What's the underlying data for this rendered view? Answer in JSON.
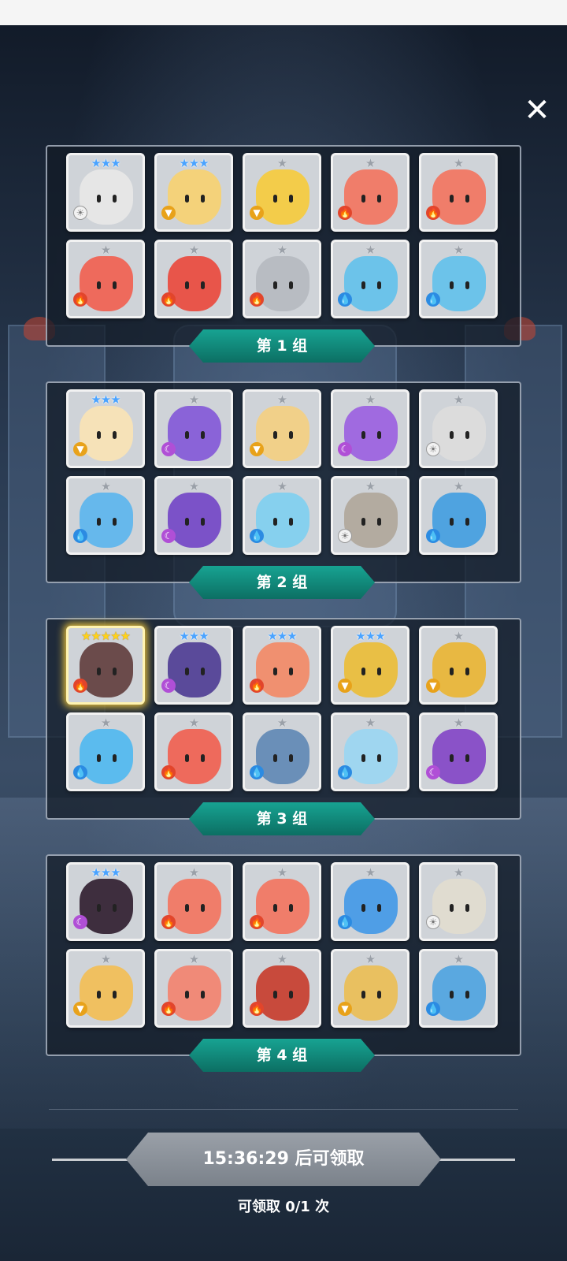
{
  "ui": {
    "close_symbol": "✕",
    "claim_button_label": "15:36:29 后可领取",
    "claim_count_text": "可领取 0/1 次"
  },
  "groups": [
    {
      "label": "第 1 组",
      "heroes": [
        {
          "stars": "★★★",
          "star_color": "blue",
          "element": "light",
          "color": "#e6e6e6"
        },
        {
          "stars": "★★★",
          "star_color": "blue",
          "element": "earth",
          "color": "#f4d27a"
        },
        {
          "stars": "★",
          "star_color": "grey",
          "element": "earth",
          "color": "#f3cc4a"
        },
        {
          "stars": "★",
          "star_color": "grey",
          "element": "fire",
          "color": "#f07d6a"
        },
        {
          "stars": "★",
          "star_color": "grey",
          "element": "fire",
          "color": "#f07d6a"
        },
        {
          "stars": "★",
          "star_color": "grey",
          "element": "fire",
          "color": "#ee6a5c"
        },
        {
          "stars": "★",
          "star_color": "grey",
          "element": "fire",
          "color": "#e8554a"
        },
        {
          "stars": "★",
          "star_color": "grey",
          "element": "fire",
          "color": "#b8bcc2"
        },
        {
          "stars": "★",
          "star_color": "grey",
          "element": "water",
          "color": "#6cc3ea"
        },
        {
          "stars": "★",
          "star_color": "grey",
          "element": "water",
          "color": "#6cc3ea"
        }
      ]
    },
    {
      "label": "第 2 组",
      "heroes": [
        {
          "stars": "★★★",
          "star_color": "blue",
          "element": "earth",
          "color": "#f6e2b8"
        },
        {
          "stars": "★",
          "star_color": "grey",
          "element": "dark",
          "color": "#8a63d8"
        },
        {
          "stars": "★",
          "star_color": "grey",
          "element": "earth",
          "color": "#f1d089"
        },
        {
          "stars": "★",
          "star_color": "grey",
          "element": "dark",
          "color": "#a06ae0"
        },
        {
          "stars": "★",
          "star_color": "grey",
          "element": "light",
          "color": "#dcdcdc"
        },
        {
          "stars": "★",
          "star_color": "grey",
          "element": "water",
          "color": "#66b8ec"
        },
        {
          "stars": "★",
          "star_color": "grey",
          "element": "dark",
          "color": "#7b52c8"
        },
        {
          "stars": "★",
          "star_color": "grey",
          "element": "water",
          "color": "#86d0ee"
        },
        {
          "stars": "★",
          "star_color": "grey",
          "element": "light",
          "color": "#b3aba0"
        },
        {
          "stars": "★",
          "star_color": "grey",
          "element": "water",
          "color": "#4fa3e0"
        }
      ]
    },
    {
      "label": "第 3 组",
      "heroes": [
        {
          "stars": "★★★★★",
          "star_color": "gold",
          "element": "fire",
          "color": "#6b4b4b",
          "highlight": true
        },
        {
          "stars": "★★★",
          "star_color": "blue",
          "element": "dark",
          "color": "#5a4a9a"
        },
        {
          "stars": "★★★",
          "star_color": "blue",
          "element": "fire",
          "color": "#f09070"
        },
        {
          "stars": "★★★",
          "star_color": "blue",
          "element": "earth",
          "color": "#e9bf45"
        },
        {
          "stars": "★",
          "star_color": "grey",
          "element": "earth",
          "color": "#e8b842"
        },
        {
          "stars": "★",
          "star_color": "grey",
          "element": "water",
          "color": "#5bbbee"
        },
        {
          "stars": "★",
          "star_color": "grey",
          "element": "fire",
          "color": "#ee6a5c"
        },
        {
          "stars": "★",
          "star_color": "grey",
          "element": "water",
          "color": "#6a8fb8"
        },
        {
          "stars": "★",
          "star_color": "grey",
          "element": "water",
          "color": "#9fd6f0"
        },
        {
          "stars": "★",
          "star_color": "grey",
          "element": "dark",
          "color": "#8a52c8"
        }
      ]
    },
    {
      "label": "第 4 组",
      "heroes": [
        {
          "stars": "★★★",
          "star_color": "blue",
          "element": "dark",
          "color": "#3e2e3e"
        },
        {
          "stars": "★",
          "star_color": "grey",
          "element": "fire",
          "color": "#f07d6a"
        },
        {
          "stars": "★",
          "star_color": "grey",
          "element": "fire",
          "color": "#f07d6a"
        },
        {
          "stars": "★",
          "star_color": "grey",
          "element": "water",
          "color": "#4f9ee6"
        },
        {
          "stars": "★",
          "star_color": "grey",
          "element": "light",
          "color": "#e0dcd0"
        },
        {
          "stars": "★",
          "star_color": "grey",
          "element": "earth",
          "color": "#f0c060"
        },
        {
          "stars": "★",
          "star_color": "grey",
          "element": "fire",
          "color": "#f08a78"
        },
        {
          "stars": "★",
          "star_color": "grey",
          "element": "fire",
          "color": "#c84a3c"
        },
        {
          "stars": "★",
          "star_color": "grey",
          "element": "earth",
          "color": "#e9c060"
        },
        {
          "stars": "★",
          "star_color": "grey",
          "element": "water",
          "color": "#5aa8e0"
        }
      ]
    }
  ],
  "element_icons": {
    "fire": "🔥",
    "water": "💧",
    "light": "☀",
    "dark": "☾",
    "earth": "▼"
  }
}
